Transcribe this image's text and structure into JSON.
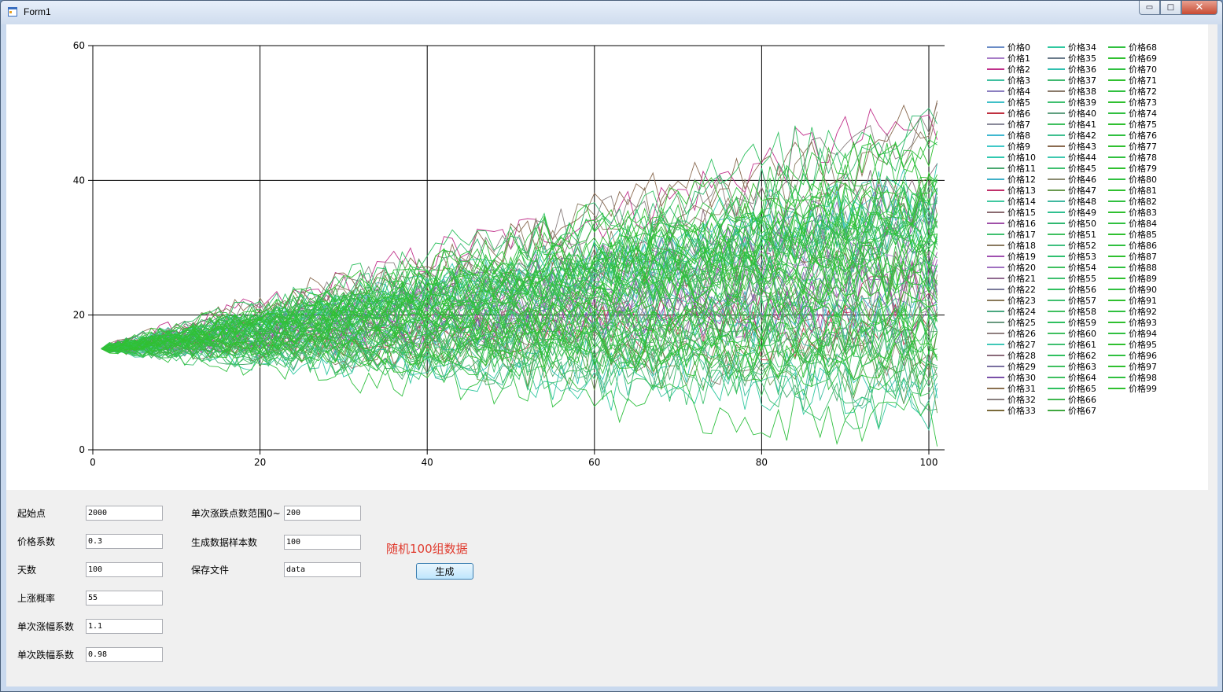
{
  "window": {
    "title": "Form1",
    "minimize_icon": "minimize-icon",
    "maximize_icon": "maximize-icon",
    "close_icon": "close-icon",
    "minimize_glyph": "▭",
    "maximize_glyph": "□",
    "close_glyph": "✕"
  },
  "form": {
    "start_point_label": "起始点",
    "start_point_value": "2000",
    "price_coef_label": "价格系数",
    "price_coef_value": "0.3",
    "days_label": "天数",
    "days_value": "100",
    "up_prob_label": "上涨概率",
    "up_prob_value": "55",
    "up_coef_label": "单次涨幅系数",
    "up_coef_value": "1.1",
    "down_coef_label": "单次跌幅系数",
    "down_coef_value": "0.98",
    "range_label": "单次涨跌点数范围0~",
    "range_value": "200",
    "samples_label": "生成数据样本数",
    "samples_value": "100",
    "save_file_label": "保存文件",
    "save_file_value": "data",
    "status_text": "随机100组数据",
    "generate_button": "生成"
  },
  "chart_data": {
    "type": "line",
    "title": "",
    "xlabel": "",
    "ylabel": "",
    "xlim": [
      0,
      100
    ],
    "ylim": [
      0,
      60
    ],
    "x_ticks": [
      "0",
      "20",
      "40",
      "60",
      "80",
      "100"
    ],
    "y_ticks": [
      "0",
      "20",
      "40",
      "60"
    ],
    "grid": true,
    "legend_placement": "right",
    "series_count": 100,
    "series_name_prefix": "价格",
    "start_value": 15,
    "x_start": 1,
    "x_end": 101,
    "end_value_range": [
      2,
      52
    ],
    "colors": [
      "#6a8cc6",
      "#a77cc7",
      "#c0308a",
      "#3fbfa0",
      "#8b7fc0",
      "#3fc0c8",
      "#c03040",
      "#8a8a9a",
      "#40b8d0",
      "#40c8c8",
      "#30c8b0",
      "#4aa870",
      "#40b0c8",
      "#c0306a",
      "#40c8a0",
      "#8a6a70",
      "#a050a8",
      "#40c070",
      "#8a7a60",
      "#a050b0",
      "#a070c0",
      "#906a90",
      "#7a7a9a",
      "#8a7a5a",
      "#4aa880",
      "#6a9a80",
      "#908080",
      "#40c8b8",
      "#8a6a7a",
      "#7a70a0",
      "#7a50a8",
      "#8a7050",
      "#8a8080",
      "#7a6a3a",
      "#30c8a0",
      "#6a7a8a",
      "#30c0b0",
      "#40b870",
      "#8a7a6a",
      "#40c070",
      "#60a080",
      "#40c060",
      "#40c090",
      "#8a6a50",
      "#40c8b0",
      "#40c070",
      "#8a8a70",
      "#6a9a50",
      "#40b8a0",
      "#30c090",
      "#30b870",
      "#40c060",
      "#40c080",
      "#30c070",
      "#40c060",
      "#40c070",
      "#30c060",
      "#40c070",
      "#40c060",
      "#30c060",
      "#40c060",
      "#40c070",
      "#30c060",
      "#40c060",
      "#40c060",
      "#30c060",
      "#40b850",
      "#40a840",
      "#30c040",
      "#30c030",
      "#30c040",
      "#30c030",
      "#30c040",
      "#30c030",
      "#30c040",
      "#30c030",
      "#30c040",
      "#30c030",
      "#30c040",
      "#30c030",
      "#30c040",
      "#30c030",
      "#30c040",
      "#30c030",
      "#30c040",
      "#30c030",
      "#30c040",
      "#30c030",
      "#30c040",
      "#30c030",
      "#30c040",
      "#30c030",
      "#30c040",
      "#30c030",
      "#30c040",
      "#30c030",
      "#30c040",
      "#30c030",
      "#30c040",
      "#30c030"
    ]
  }
}
